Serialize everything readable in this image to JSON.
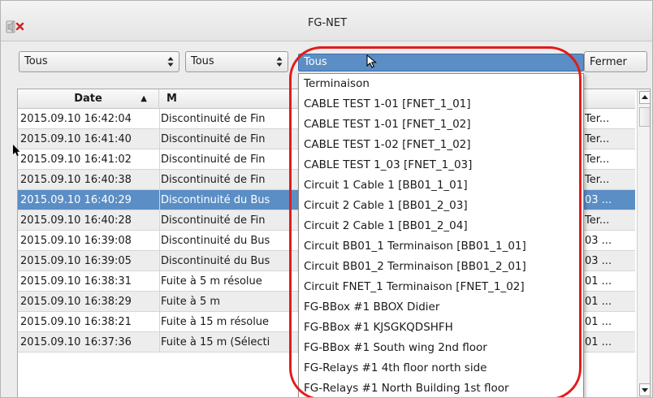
{
  "window": {
    "title": "FG-NET",
    "icon": "speaker-muted-icon"
  },
  "toolbar": {
    "filter1": {
      "value": "Tous"
    },
    "filter2": {
      "value": "Tous"
    },
    "filter3": {
      "value": "Tous"
    },
    "close_label": "Fermer"
  },
  "table": {
    "columns": {
      "date": "Date",
      "message": "M"
    },
    "rows": [
      {
        "date": "2015.09.10 16:42:04",
        "message": "Discontinuité de Fin",
        "tail": "Ter..."
      },
      {
        "date": "2015.09.10 16:41:40",
        "message": "Discontinuité de Fin",
        "tail": "Ter..."
      },
      {
        "date": "2015.09.10 16:41:02",
        "message": "Discontinuité de Fin",
        "tail": "Ter..."
      },
      {
        "date": "2015.09.10 16:40:38",
        "message": "Discontinuité de Fin",
        "tail": "Ter..."
      },
      {
        "date": "2015.09.10 16:40:29",
        "message": "Discontinuité du Bus",
        "tail": "03 ...",
        "selected": true
      },
      {
        "date": "2015.09.10 16:40:28",
        "message": "Discontinuité de Fin",
        "tail": "Ter..."
      },
      {
        "date": "2015.09.10 16:39:08",
        "message": "Discontinuité du Bus",
        "tail": "03 ..."
      },
      {
        "date": "2015.09.10 16:39:05",
        "message": "Discontinuité du Bus",
        "tail": "03 ..."
      },
      {
        "date": "2015.09.10 16:38:31",
        "message": "Fuite à 5 m  résolue",
        "tail": "01 ..."
      },
      {
        "date": "2015.09.10 16:38:29",
        "message": "Fuite à 5 m",
        "tail": "01 ..."
      },
      {
        "date": "2015.09.10 16:38:21",
        "message": "Fuite à 15 m  résolue",
        "tail": "01 ..."
      },
      {
        "date": "2015.09.10 16:37:36",
        "message": "Fuite à 15 m  (Sélecti",
        "tail": "01 ..."
      }
    ]
  },
  "dropdown": {
    "items": [
      "Terminaison",
      "CABLE TEST 1-01 [FNET_1_01]",
      "CABLE TEST 1-01 [FNET_1_02]",
      "CABLE TEST 1-02 [FNET_1_02]",
      "CABLE TEST 1_03 [FNET_1_03]",
      "Circuit 1 Cable 1 [BB01_1_01]",
      "Circuit 2 Cable 1 [BB01_2_03]",
      "Circuit 2 Cable 1 [BB01_2_04]",
      "Circuit BB01_1 Terminaison [BB01_1_01]",
      "Circuit BB01_2 Terminaison [BB01_2_01]",
      "Circuit FNET_1 Terminaison [FNET_1_02]",
      "FG-BBox #1 BBOX Didier",
      "FG-BBox #1 KJSGKQDSHFH",
      "FG-BBox #1 South wing 2nd floor",
      "FG-Relays #1 4th floor north side",
      "FG-Relays #1 North Building 1st floor"
    ]
  },
  "colors": {
    "selection": "#5b8ec5",
    "highlight_ring": "#e21b1b"
  }
}
